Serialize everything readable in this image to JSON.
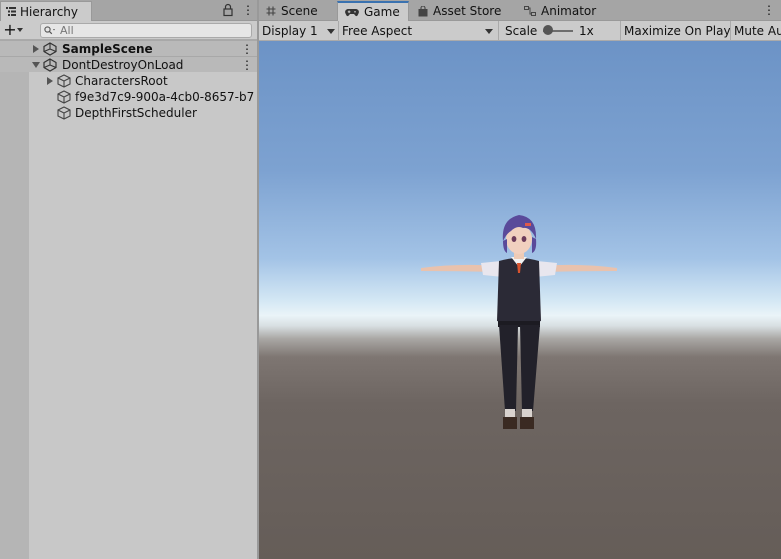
{
  "hierarchy": {
    "tab_label": "Hierarchy",
    "search_placeholder": "All",
    "scenes": [
      {
        "label": "SampleScene",
        "expanded": false,
        "bold": true
      },
      {
        "label": "DontDestroyOnLoad",
        "expanded": true,
        "bold": false
      }
    ],
    "objects": [
      {
        "label": "CharactersRoot",
        "has_children": true
      },
      {
        "label": "f9e3d7c9-900a-4cb0-8657-b7",
        "has_children": false
      },
      {
        "label": "DepthFirstScheduler",
        "has_children": false
      }
    ]
  },
  "tabs": [
    {
      "label": "Scene",
      "icon": "hash-icon"
    },
    {
      "label": "Game",
      "icon": "gamepad-icon",
      "active": true
    },
    {
      "label": "Asset Store",
      "icon": "shopping-bag-icon"
    },
    {
      "label": "Animator",
      "icon": "animator-icon"
    }
  ],
  "game_toolbar": {
    "display": "Display 1",
    "aspect": "Free Aspect",
    "scale_label": "Scale",
    "scale_value": "1x",
    "maximize": "Maximize On Play",
    "mute": "Mute Au"
  },
  "colors": {
    "sky_top": "#6c93c6",
    "horizon": "#eaf4f8",
    "ground": "#655d58",
    "active_tab_accent": "#3a72b0"
  }
}
